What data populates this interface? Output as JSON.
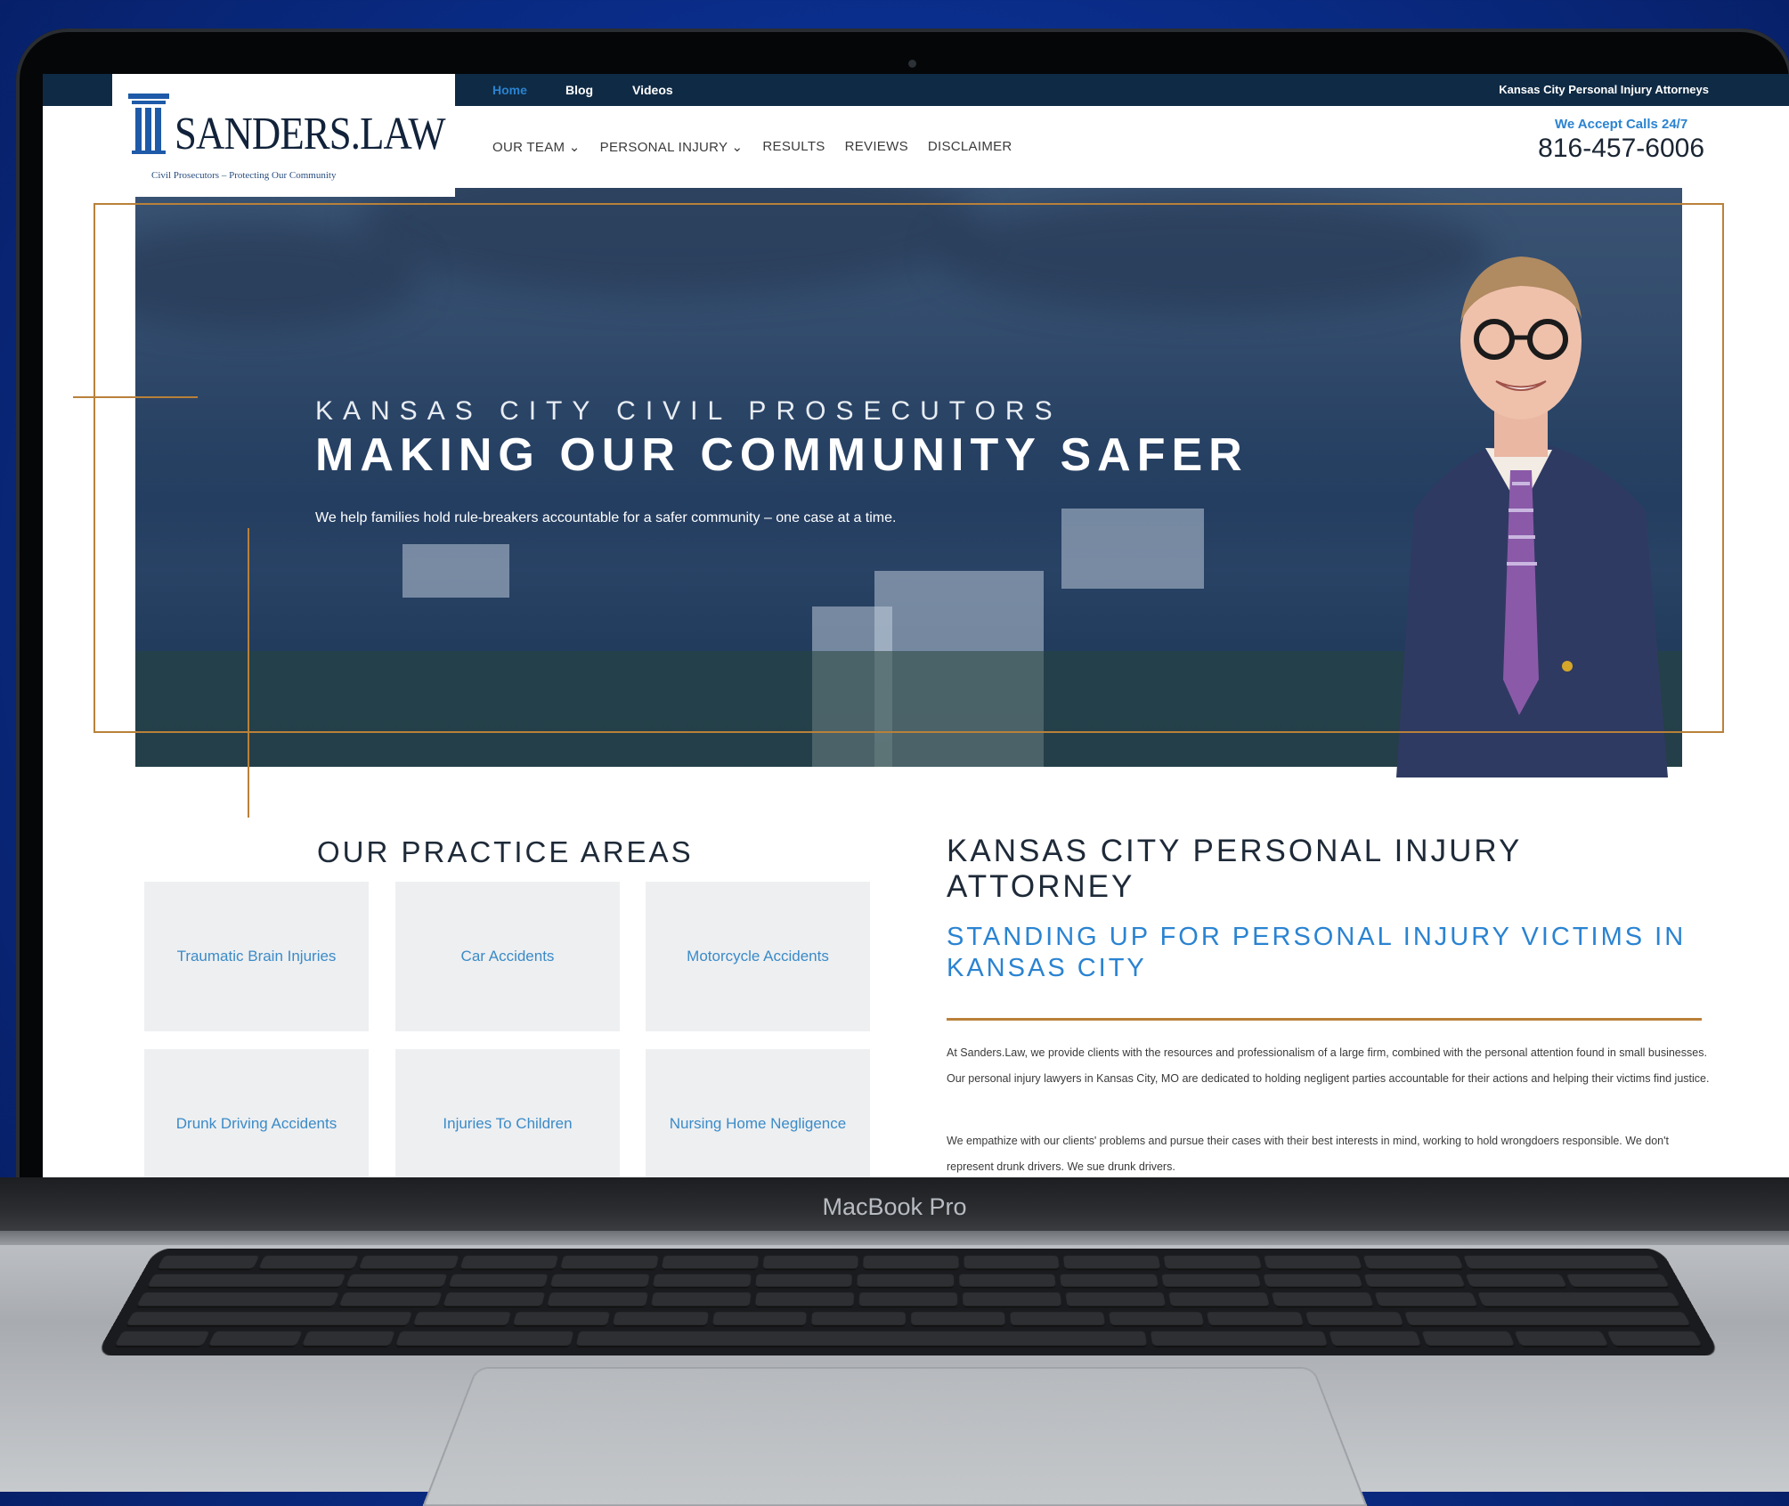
{
  "device": {
    "chin_label": "MacBook Pro"
  },
  "site": {
    "topbar": {
      "links": [
        "Home",
        "Blog",
        "Videos"
      ],
      "tagline": "Kansas City Personal Injury Attorneys"
    },
    "logo": {
      "text": "SANDERS.LAW",
      "subtitle": "Civil Prosecutors – Protecting Our Community"
    },
    "nav": {
      "items": [
        "OUR TEAM ⌄",
        "PERSONAL INJURY ⌄",
        "RESULTS",
        "REVIEWS",
        "DISCLAIMER"
      ]
    },
    "call": {
      "label": "We Accept Calls 24/7",
      "number": "816-457-6006"
    },
    "hero": {
      "kicker": "KANSAS CITY CIVIL PROSECUTORS",
      "title": "MAKING OUR COMMUNITY SAFER",
      "subtitle": "We help families hold rule-breakers accountable for a safer community – one case at a time."
    },
    "practice_areas": {
      "title": "OUR PRACTICE AREAS",
      "items": [
        "Traumatic Brain Injuries",
        "Car Accidents",
        "Motorcycle Accidents",
        "Drunk Driving Accidents",
        "Injuries To Children",
        "Nursing Home Negligence"
      ]
    },
    "about": {
      "title": "KANSAS CITY PERSONAL INJURY ATTORNEY",
      "subtitle": "STANDING UP FOR PERSONAL INJURY VICTIMS IN KANSAS CITY",
      "paragraphs": [
        "At Sanders.Law, we provide clients with the resources and professionalism of a large firm, combined with the personal attention found in small businesses. Our personal injury lawyers in Kansas City, MO are dedicated to holding negligent parties accountable for their actions and helping their victims find justice.",
        "We empathize with our clients' problems and pursue their cases with their best interests in mind, working to hold wrongdoers responsible. We don't represent drunk drivers. We sue drunk drivers."
      ]
    },
    "colors": {
      "navy": "#0f2a44",
      "accent_blue": "#2a83d1",
      "gold": "#b9813a"
    }
  }
}
